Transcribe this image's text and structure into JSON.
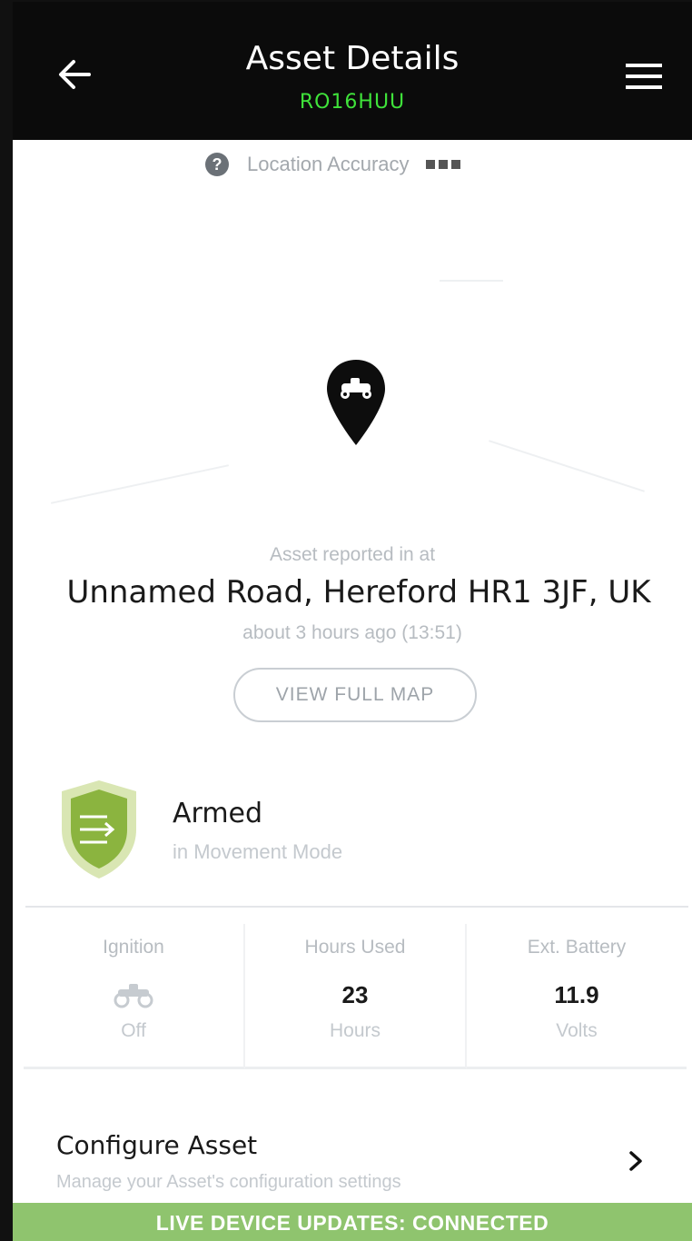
{
  "header": {
    "title": "Asset Details",
    "subtitle": "RO16HUU",
    "back_icon": "arrow-left-icon",
    "menu_icon": "hamburger-menu-icon"
  },
  "location": {
    "accuracy_label": "Location Accuracy",
    "help_icon": "question-icon",
    "help_glyph": "?",
    "accuracy_bars": 3
  },
  "map": {
    "marker_icon": "quad-bike-location-pin-icon",
    "reported_label": "Asset reported in at",
    "address": "Unnamed Road, Hereford HR1 3JF, UK",
    "time_ago": "about 3 hours ago (13:51)",
    "view_map_label": "VIEW FULL MAP"
  },
  "security": {
    "icon": "shield-icon",
    "state": "Armed",
    "mode": "in Movement Mode"
  },
  "stats": [
    {
      "label": "Ignition",
      "icon": "quad-bike-icon",
      "unit": "Off"
    },
    {
      "label": "Hours Used",
      "value": "23",
      "unit": "Hours"
    },
    {
      "label": "Ext. Battery",
      "value": "11.9",
      "unit": "Volts"
    }
  ],
  "configure": {
    "title": "Configure Asset",
    "subtitle": "Manage your Asset's configuration settings",
    "icon": "chevron-right-icon"
  },
  "status_bar": {
    "text": "LIVE DEVICE UPDATES: CONNECTED"
  },
  "colors": {
    "header_bg": "#0b0b0b",
    "plate_green": "#3fe23a",
    "status_green": "#8fc46e",
    "shield_green": "#8bb43f"
  }
}
